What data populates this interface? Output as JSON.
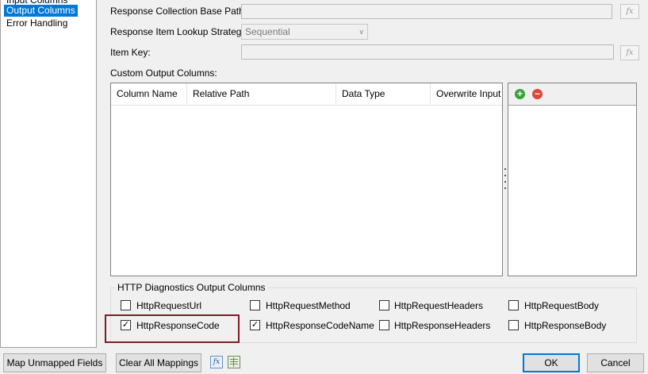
{
  "nav": {
    "items": [
      "Input Columns",
      "Output Columns",
      "Error Handling"
    ],
    "selected": 1
  },
  "form": {
    "base_path_label": "Response Collection Base Path:",
    "lookup_label": "Response Item Lookup Strategy:",
    "lookup_value": "Sequential",
    "item_key_label": "Item Key:",
    "fx_label": "fx",
    "custom_columns_label": "Custom Output Columns:"
  },
  "grid": {
    "columns": [
      "Column Name",
      "Relative Path",
      "Data Type",
      "Overwrite Input"
    ]
  },
  "side_buttons": {
    "add": "+",
    "remove": "−"
  },
  "diagnostics": {
    "title": "HTTP Diagnostics Output Columns",
    "options": [
      {
        "label": "HttpRequestUrl",
        "checked": false
      },
      {
        "label": "HttpRequestMethod",
        "checked": false
      },
      {
        "label": "HttpRequestHeaders",
        "checked": false
      },
      {
        "label": "HttpRequestBody",
        "checked": false
      },
      {
        "label": "HttpResponseCode",
        "checked": true
      },
      {
        "label": "HttpResponseCodeName",
        "checked": true
      },
      {
        "label": "HttpResponseHeaders",
        "checked": false
      },
      {
        "label": "HttpResponseBody",
        "checked": false
      }
    ]
  },
  "footer": {
    "map_unmapped": "Map Unmapped Fields",
    "clear_mappings": "Clear All Mappings",
    "fx_icon_label": "fx",
    "ok": "OK",
    "cancel": "Cancel"
  },
  "colors": {
    "highlight_box": "#7b1f25",
    "selection": "#0078d7",
    "add": "#3aa33a",
    "remove": "#e0453a"
  }
}
